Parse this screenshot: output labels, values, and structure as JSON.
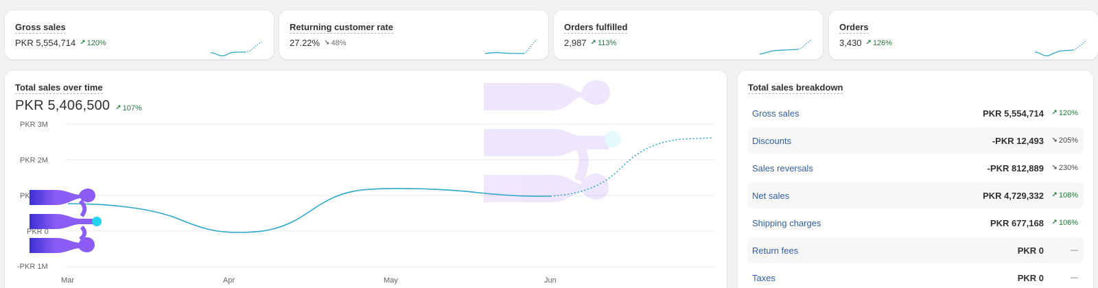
{
  "metrics": [
    {
      "title": "Gross sales",
      "value": "PKR 5,554,714",
      "delta": "120%",
      "direction": "up",
      "arrow": "↗"
    },
    {
      "title": "Returning customer rate",
      "value": "27.22%",
      "delta": "48%",
      "direction": "down",
      "arrow": "↘"
    },
    {
      "title": "Orders fulfilled",
      "value": "2,987",
      "delta": "113%",
      "direction": "up",
      "arrow": "↗"
    },
    {
      "title": "Orders",
      "value": "3,430",
      "delta": "126%",
      "direction": "up",
      "arrow": "↗"
    }
  ],
  "sales_over_time": {
    "title": "Total sales over time",
    "total": "PKR 5,406,500",
    "delta": "107%",
    "arrow": "↗",
    "y_ticks": [
      "PKR 3M",
      "PKR 2M",
      "PKR 1M",
      "PKR 0",
      "-PKR 1M"
    ],
    "x_ticks": [
      "Mar",
      "Apr",
      "May",
      "Jun"
    ]
  },
  "breakdown": {
    "title": "Total sales breakdown",
    "rows": [
      {
        "label": "Gross sales",
        "value": "PKR 5,554,714",
        "arrow": "↗",
        "delta": "120%",
        "direction": "up"
      },
      {
        "label": "Discounts",
        "value": "-PKR 12,493",
        "arrow": "↘",
        "delta": "205%",
        "direction": "down"
      },
      {
        "label": "Sales reversals",
        "value": "-PKR 812,889",
        "arrow": "↘",
        "delta": "230%",
        "direction": "down"
      },
      {
        "label": "Net sales",
        "value": "PKR 4,729,332",
        "arrow": "↗",
        "delta": "108%",
        "direction": "up"
      },
      {
        "label": "Shipping charges",
        "value": "PKR 677,168",
        "arrow": "↗",
        "delta": "106%",
        "direction": "up"
      },
      {
        "label": "Return fees",
        "value": "PKR 0",
        "arrow": "",
        "delta": "—",
        "direction": "none"
      },
      {
        "label": "Taxes",
        "value": "PKR 0",
        "arrow": "",
        "delta": "—",
        "direction": "none"
      }
    ]
  },
  "colors": {
    "line": "#2aa6c9",
    "accent_up": "#1f7a3a",
    "link": "#2c5ea8",
    "overlay_purple": "#7c3aed",
    "overlay_cyan": "#22d3ee"
  }
}
